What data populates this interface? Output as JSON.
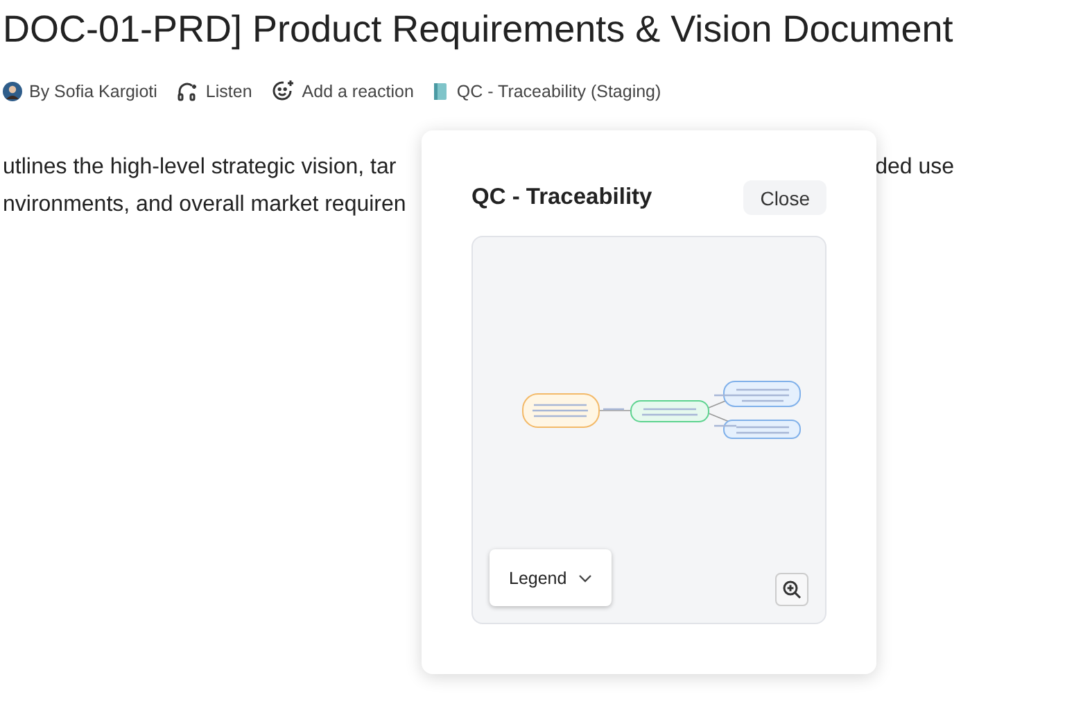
{
  "document": {
    "title": "DOC-01-PRD] Product Requirements & Vision Document",
    "meta": [
      {
        "kind": "author",
        "label": "By Sofia Kargioti"
      },
      {
        "kind": "listen",
        "label": "Listen"
      },
      {
        "kind": "reaction",
        "label": "Add a reaction"
      },
      {
        "kind": "page",
        "label": "QC - Traceability (Staging)"
      }
    ],
    "description_lines": [
      {
        "left": "utlines the high-level strategic vision, tar",
        "right": "ded use"
      },
      {
        "left": "nvironments, and overall market requiren"
      }
    ]
  },
  "popup": {
    "title": "QC - Traceability",
    "close": "Close",
    "legend": "Legend"
  }
}
